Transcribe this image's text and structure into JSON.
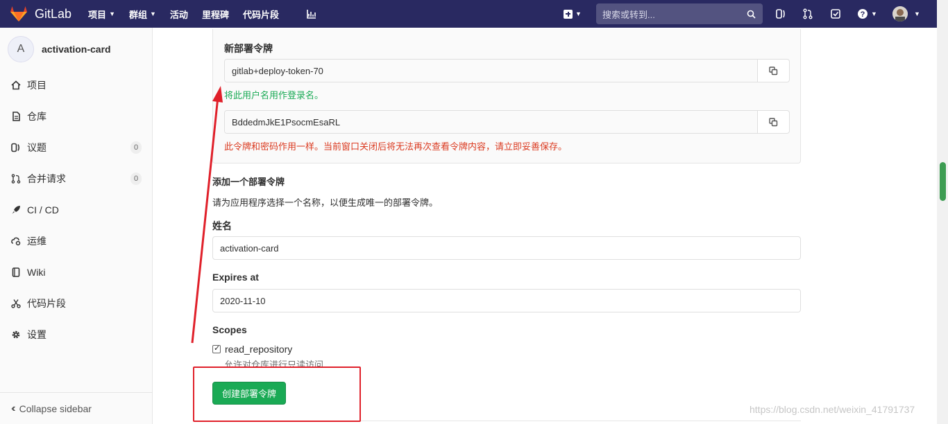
{
  "brand": {
    "name": "GitLab"
  },
  "nav": {
    "items": [
      "项目",
      "群组",
      "活动",
      "里程碑",
      "代码片段"
    ]
  },
  "search": {
    "placeholder": "搜索或转到..."
  },
  "sidebar": {
    "project_initial": "A",
    "project_name": "activation-card",
    "items": [
      {
        "label": "项目",
        "icon": "home-icon"
      },
      {
        "label": "仓库",
        "icon": "doc-icon"
      },
      {
        "label": "议题",
        "icon": "issues-icon",
        "badge": "0"
      },
      {
        "label": "合并请求",
        "icon": "merge-icon",
        "badge": "0"
      },
      {
        "label": "CI / CD",
        "icon": "rocket-icon"
      },
      {
        "label": "运维",
        "icon": "cloud-gear-icon"
      },
      {
        "label": "Wiki",
        "icon": "book-icon"
      },
      {
        "label": "代码片段",
        "icon": "scissors-icon"
      },
      {
        "label": "设置",
        "icon": "gear-icon"
      }
    ],
    "collapse_label": "Collapse sidebar"
  },
  "token_panel": {
    "title": "新部署令牌",
    "username": "gitlab+deploy-token-70",
    "username_help": "将此用户名用作登录名。",
    "password": "BddedmJkE1PsocmEsaRL",
    "password_help": "此令牌和密码作用一样。当前窗口关闭后将无法再次查看令牌内容，请立即妥善保存。"
  },
  "form": {
    "heading": "添加一个部署令牌",
    "description": "请为应用程序选择一个名称，以便生成唯一的部署令牌。",
    "name_label": "姓名",
    "name_value": "activation-card",
    "expires_label": "Expires at",
    "expires_value": "2020-11-10",
    "scopes_label": "Scopes",
    "scope_read_repository": "read_repository",
    "scope_read_repository_help": "允许对仓库进行只读访问",
    "submit_label": "创建部署令牌"
  },
  "watermark": "https://blog.csdn.net/weixin_41791737",
  "colors": {
    "header": "#292961",
    "green": "#1aaa55",
    "red_text": "#db3b21",
    "annotation_red": "#e0202a"
  }
}
